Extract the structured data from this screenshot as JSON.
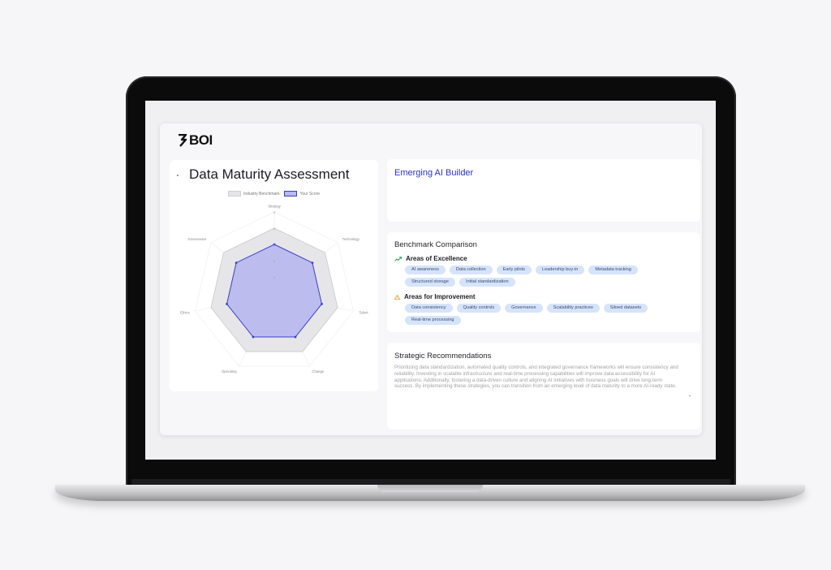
{
  "brand": {
    "logo_text": "BOI"
  },
  "assessment": {
    "title": "Data Maturity Assessment",
    "legend": {
      "benchmark": "Industry Benchmark",
      "score": "Your Score"
    },
    "colors": {
      "benchmark_fill": "#e6e6e8",
      "benchmark_stroke": "#c9c9cd",
      "score_fill": "#b7b8ee",
      "score_stroke": "#3a3fc9"
    }
  },
  "chart_data": {
    "type": "radar",
    "categories": [
      "Strategy",
      "Technology",
      "Talent",
      "Change",
      "Operating",
      "Ethics",
      "Governance"
    ],
    "rlim": [
      0,
      5
    ],
    "ticks": [
      "1",
      "2",
      "3",
      "4",
      "5"
    ],
    "series": [
      {
        "name": "Industry Benchmark",
        "values": [
          4,
          4,
          4,
          4,
          4,
          4,
          4
        ]
      },
      {
        "name": "Your Score",
        "values": [
          3,
          3,
          3,
          3,
          3,
          3,
          3
        ]
      }
    ],
    "legend_position": "top"
  },
  "persona": {
    "title": "Emerging AI Builder"
  },
  "benchmark": {
    "title": "Benchmark Comparison",
    "excellence": {
      "heading": "Areas of Excellence",
      "icon": "trending-up-icon",
      "items": [
        "AI awareness",
        "Data collection",
        "Early pilots",
        "Leadership buy-in",
        "Metadata tracking",
        "Structured storage",
        "Initial standardization"
      ]
    },
    "improvement": {
      "heading": "Areas for Improvement",
      "icon": "warning-icon",
      "items": [
        "Data consistency",
        "Quality controls",
        "Governance",
        "Scalability practices",
        "Siloed datasets",
        "Real-time processing"
      ]
    }
  },
  "recommendations": {
    "title": "Strategic Recommendations",
    "text": "Prioritizing data standardization, automated quality controls, and integrated governance frameworks will ensure consistency and reliability. Investing in scalable infrastructure and real-time processing capabilities will improve data accessibility for AI applications. Additionally, fostering a data-driven culture and aligning AI initiatives with business goals will drive long-term success. By implementing these strategies, you can transition from an emerging level of data maturity to a more AI-ready state."
  }
}
